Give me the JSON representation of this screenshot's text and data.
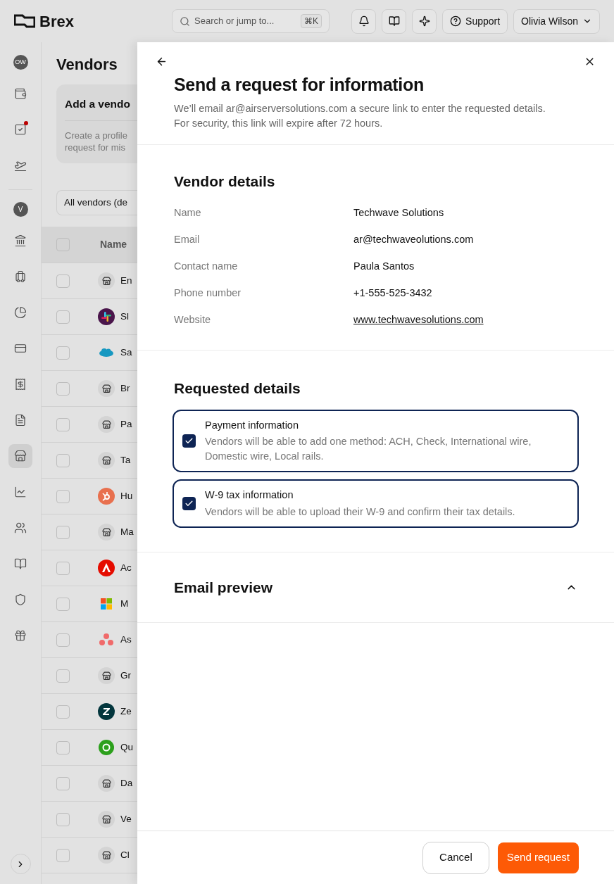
{
  "topbar": {
    "logo": "Brex",
    "search": {
      "placeholder": "Search or jump to...",
      "shortcut": "⌘K"
    },
    "support": "Support",
    "user": "Olivia Wilson"
  },
  "sidebar": {
    "avatar": "OW",
    "entity": "V",
    "items": [
      {
        "selected": false,
        "badge": false
      },
      {
        "selected": false,
        "badge": true
      },
      {
        "selected": false,
        "badge": false
      },
      {
        "selected": false,
        "badge": false
      },
      {
        "selected": false,
        "badge": false
      },
      {
        "selected": false,
        "badge": false
      },
      {
        "selected": false,
        "badge": false
      },
      {
        "selected": false,
        "badge": false
      },
      {
        "selected": false,
        "badge": false
      },
      {
        "selected": true,
        "badge": false
      },
      {
        "selected": false,
        "badge": false
      },
      {
        "selected": false,
        "badge": false
      },
      {
        "selected": false,
        "badge": false
      },
      {
        "selected": false,
        "badge": false
      },
      {
        "selected": false,
        "badge": false
      }
    ]
  },
  "page": {
    "title": "Vendors",
    "card": {
      "title": "Add a vendo",
      "text": "Create a profile",
      "text2": "request for mis"
    },
    "filter": "All vendors (de",
    "table": {
      "column": "Name",
      "all_checked": false,
      "rows": [
        {
          "name": "En",
          "kind": "store",
          "checked": false
        },
        {
          "name": "Sl",
          "kind": "pinwheel",
          "checked": false
        },
        {
          "name": "Sa",
          "kind": "cloud",
          "checked": false
        },
        {
          "name": "Br",
          "kind": "store",
          "checked": false
        },
        {
          "name": "Pa",
          "kind": "store",
          "checked": false
        },
        {
          "name": "Ta",
          "kind": "store",
          "checked": false
        },
        {
          "name": "Hu",
          "kind": "hub",
          "checked": false
        },
        {
          "name": "Ma",
          "kind": "store",
          "checked": false
        },
        {
          "name": "Ac",
          "kind": "peak",
          "checked": false
        },
        {
          "name": "M",
          "kind": "squares",
          "checked": false
        },
        {
          "name": "As",
          "kind": "dots",
          "checked": false
        },
        {
          "name": "Gr",
          "kind": "store",
          "checked": false
        },
        {
          "name": "Ze",
          "kind": "zed",
          "checked": false
        },
        {
          "name": "Qu",
          "kind": "ring",
          "checked": false
        },
        {
          "name": "Da",
          "kind": "store",
          "checked": false
        },
        {
          "name": "Ve",
          "kind": "store",
          "checked": false
        },
        {
          "name": "Cl",
          "kind": "store",
          "checked": false
        }
      ]
    }
  },
  "drawer": {
    "title": "Send a request for information",
    "subtitle": "We’ll email ar@airserversolutions.com a secure link to enter the requested details.",
    "subtitle2": "For security, this link will expire after 72 hours.",
    "vendor_details": {
      "heading": "Vendor details",
      "fields": [
        {
          "label": "Name",
          "value": "Techwave Solutions",
          "kind": "text"
        },
        {
          "label": "Email",
          "value": "ar@techwaveolutions.com",
          "kind": "text"
        },
        {
          "label": "Contact name",
          "value": "Paula Santos",
          "kind": "text"
        },
        {
          "label": "Phone number",
          "value": "+1-555-525-3432",
          "kind": "text"
        },
        {
          "label": "Website",
          "value": "www.techwavesolutions.com",
          "kind": "link"
        }
      ]
    },
    "requested_details": {
      "heading": "Requested details",
      "options": [
        {
          "title": "Payment information",
          "description": "Vendors will be able to add one method: ACH, Check, International wire, Domestic wire, Local rails.",
          "checked": true
        },
        {
          "title": "W-9 tax information",
          "description": "Vendors will be able to upload their W-9 and confirm their tax details.",
          "checked": true
        }
      ]
    },
    "email_preview": {
      "heading": "Email preview",
      "expanded": true
    },
    "buttons": {
      "cancel": "Cancel",
      "submit": "Send request"
    }
  }
}
